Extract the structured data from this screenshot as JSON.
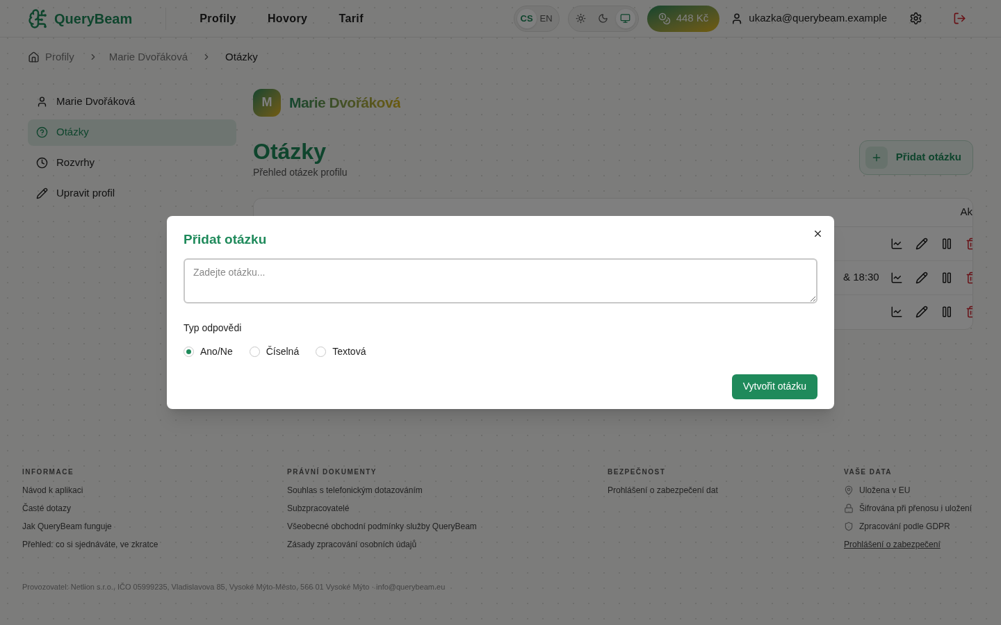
{
  "header": {
    "brand": "QueryBeam",
    "nav": [
      {
        "label": "Profily"
      },
      {
        "label": "Hovory"
      },
      {
        "label": "Tarif"
      }
    ],
    "languages": [
      {
        "label": "CS",
        "selected": true
      },
      {
        "label": "EN",
        "selected": false
      }
    ],
    "themes": [
      {
        "kind": "light",
        "selected": false
      },
      {
        "kind": "dark",
        "selected": false
      },
      {
        "kind": "system",
        "selected": true
      }
    ],
    "credit": "448 Kč",
    "user": "ukazka@querybeam.example"
  },
  "breadcrumb": [
    "Profily",
    "Marie Dvořáková",
    "Otázky"
  ],
  "sidebar": {
    "items": [
      {
        "label": "Marie Dvořáková",
        "kind": "user",
        "selected": false
      },
      {
        "label": "Otázky",
        "kind": "question",
        "selected": true
      },
      {
        "label": "Rozvrhy",
        "kind": "clock",
        "selected": false
      },
      {
        "label": "Upravit profil",
        "kind": "pencil",
        "selected": false
      }
    ]
  },
  "profile": {
    "initial": "M",
    "name": "Marie Dvořáková"
  },
  "page": {
    "title": "Otázky",
    "subtitle": "Přehled otázek profilu",
    "add_button": "Přidat otázku"
  },
  "table": {
    "columns": [
      "Ak"
    ],
    "rows": [
      {
        "kind": "actions"
      },
      {
        "kind": "time",
        "cell": "& 18:30"
      },
      {
        "kind": "actions"
      }
    ]
  },
  "dialog": {
    "title": "Přidat otázku",
    "placeholder": "Zadejte otázku...",
    "answer_type_label": "Typ odpovědi",
    "options": [
      {
        "label": "Ano/Ne",
        "selected": true
      },
      {
        "label": "Číselná",
        "selected": false
      },
      {
        "label": "Textová",
        "selected": false
      }
    ],
    "submit": "Vytvořit otázku"
  },
  "footer": {
    "columns": [
      {
        "heading": "INFORMACE",
        "items": [
          {
            "label": "Návod k aplikaci",
            "kind": "plain"
          },
          {
            "label": "Časté dotazy",
            "kind": "plain"
          },
          {
            "label": "Jak QueryBeam funguje",
            "kind": "plain"
          },
          {
            "label": "Přehled: co si sjednáváte, ve zkratce",
            "kind": "plain"
          }
        ]
      },
      {
        "heading": "PRÁVNÍ DOKUMENTY",
        "items": [
          {
            "label": "Souhlas s telefonickým dotazováním",
            "kind": "plain"
          },
          {
            "label": "Subzpracovatelé",
            "kind": "plain"
          },
          {
            "label": "Všeobecné obchodní podmínky služby QueryBeam",
            "kind": "plain"
          },
          {
            "label": "Zásady zpracování osobních údajů",
            "kind": "plain"
          }
        ]
      },
      {
        "heading": "BEZPEČNOST",
        "items": [
          {
            "label": "Prohlášení o zabezpečení dat",
            "kind": "plain"
          }
        ]
      },
      {
        "heading": "VAŠE DATA",
        "items": [
          {
            "label": "Uložena v EU",
            "kind": "location"
          },
          {
            "label": "Šifrována při přenosu i uložení",
            "kind": "lock"
          },
          {
            "label": "Zpracování podle GDPR",
            "kind": "shield"
          },
          {
            "label": "Prohlášení o zabezpečení",
            "kind": "underlined"
          }
        ]
      }
    ],
    "legal": "Provozovatel: Netlion s.r.o., IČO 05999235, Vladislavova 85, Vysoké Mýto-Město, 566 01 Vysoké Mýto · info@querybeam.eu"
  }
}
